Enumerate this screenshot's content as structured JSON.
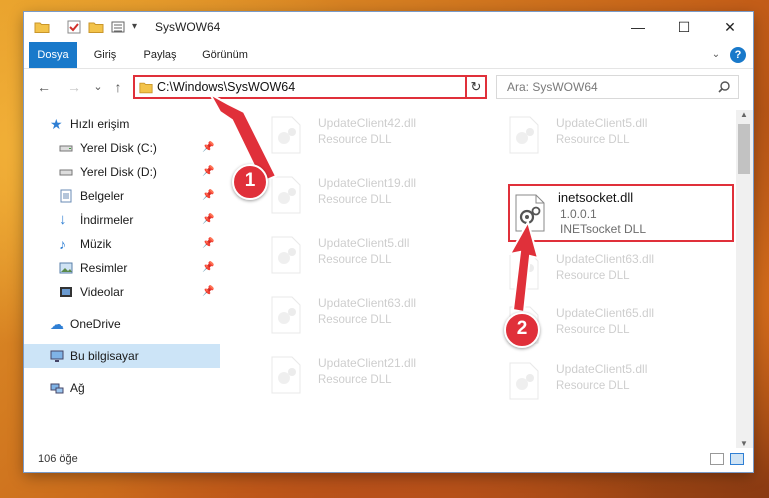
{
  "window": {
    "title": "SysWOW64"
  },
  "window_controls": {
    "minimize": "—",
    "maximize": "☐",
    "close": "✕"
  },
  "ribbon": {
    "tabs": [
      "Dosya",
      "Giriş",
      "Paylaş",
      "Görünüm"
    ],
    "active": "Dosya",
    "help": "?"
  },
  "nav": {
    "back": "←",
    "forward": "→",
    "recent": "⌄",
    "up": "↑"
  },
  "address": {
    "path": "C:\\Windows\\SysWOW64",
    "dropdown": "⌄",
    "refresh": "↻"
  },
  "search": {
    "placeholder": "Ara: SysWOW64",
    "icon": "search-icon"
  },
  "sidebar": {
    "quick_access": "Hızlı erişim",
    "items": [
      {
        "label": "Yerel Disk (C:)",
        "icon": "drive-icon"
      },
      {
        "label": "Yerel Disk (D:)",
        "icon": "drive-icon"
      },
      {
        "label": "Belgeler",
        "icon": "documents-icon"
      },
      {
        "label": "İndirmeler",
        "icon": "downloads-icon"
      },
      {
        "label": "Müzik",
        "icon": "music-icon"
      },
      {
        "label": "Resimler",
        "icon": "pictures-icon"
      },
      {
        "label": "Videolar",
        "icon": "videos-icon"
      }
    ],
    "onedrive": "OneDrive",
    "this_pc": "Bu bilgisayar",
    "network": "Ağ"
  },
  "files": {
    "left": [
      {
        "name": "UpdateClient42.dll",
        "type": "Resource DLL"
      },
      {
        "name": "UpdateClient19.dll",
        "type": "Resource DLL"
      },
      {
        "name": "UpdateClient5.dll",
        "type": "Resource DLL"
      },
      {
        "name": "UpdateClient63.dll",
        "type": "Resource DLL"
      },
      {
        "name": "UpdateClient21.dll",
        "type": "Resource DLL"
      }
    ],
    "right": [
      {
        "name": "UpdateClient5.dll",
        "type": "Resource DLL"
      },
      {
        "name": "UpdateClient63.dll",
        "type": "Resource DLL"
      },
      {
        "name": "UpdateClient65.dll",
        "type": "Resource DLL"
      },
      {
        "name": "UpdateClient5.dll",
        "type": "Resource DLL"
      }
    ],
    "highlighted": {
      "name": "inetsocket.dll",
      "version": "1.0.0.1",
      "description": "INETsocket DLL"
    }
  },
  "status": {
    "count": "106 öğe"
  },
  "callouts": [
    "1",
    "2"
  ],
  "colors": {
    "accent": "#1979ca",
    "highlight": "#e0303a",
    "selected": "#cce4f7"
  }
}
